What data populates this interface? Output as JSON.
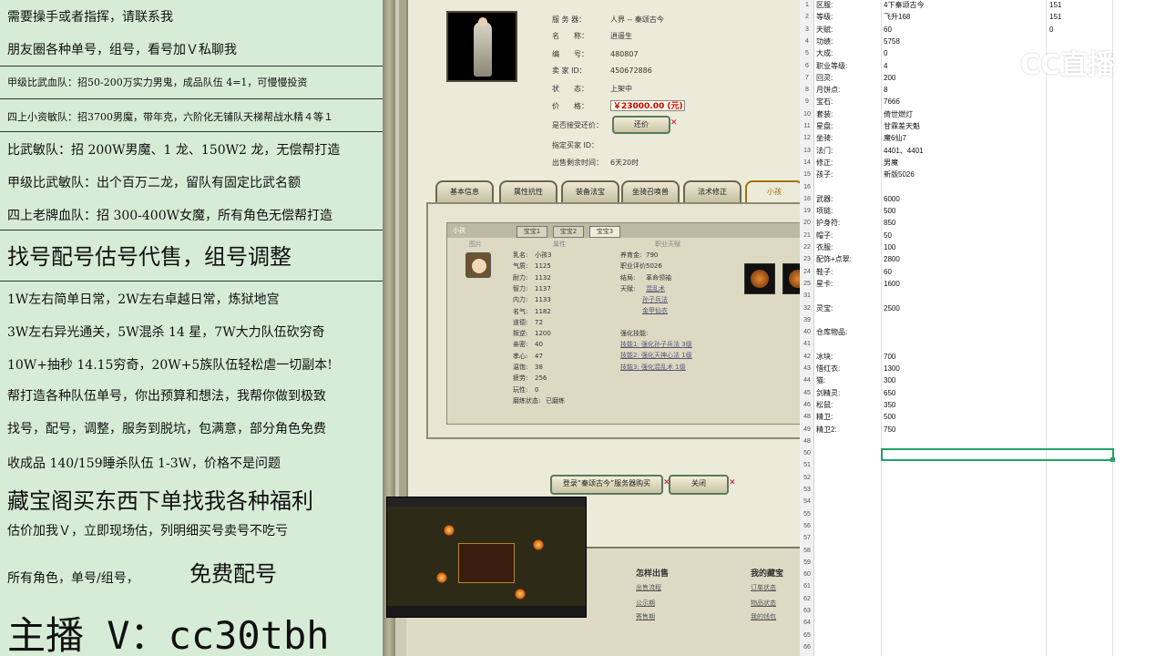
{
  "ad_panel": {
    "lines": [
      {
        "text": "需要操手或者指挥，请联系我",
        "size": "md"
      },
      {
        "text": "朋友圈各种单号，组号，看号加Ｖ私聊我",
        "size": "md"
      },
      {
        "text": "甲级比武血队：招50-200万实力男鬼，成品队伍 4=1，可慢慢投资",
        "size": "sm"
      },
      {
        "text": "四上小资敏队：招3700男魔，带年克，六阶化无铺队天梯帮战水精４等１",
        "size": "sm"
      },
      {
        "text": "比武敏队：招 200W男魔、1 龙、150W2 龙，无偿帮打造",
        "size": "md"
      },
      {
        "text": "甲级比武敏队：出个百万二龙，留队有固定比武名额",
        "size": "md"
      },
      {
        "text": "四上老牌血队：招 300-400W女魔，所有角色无偿帮打造",
        "size": "md"
      },
      {
        "text": "找号配号估号代售，组号调整",
        "size": "xl"
      },
      {
        "text": "1W左右简单日常，2W左右卓越日常，炼狱地宫",
        "size": "md"
      },
      {
        "text": "3W左右异光通关，5W混杀 14 星，7W大力队伍砍穷奇",
        "size": "md"
      },
      {
        "text": "10W+抽秒 14.15穷奇，20W+5族队伍轻松虐一切副本!",
        "size": "md"
      },
      {
        "text": "帮打造各种队伍单号，你出预算和想法，我帮你做到极致",
        "size": "md"
      },
      {
        "text": "找号，配号，调整，服务到脱坑，包满意，部分角色免费",
        "size": "md"
      },
      {
        "text": "收成品 140/159睡杀队伍 1-3W，价格不是问题",
        "size": "md"
      },
      {
        "text": "藏宝阁买东西下单找我各种福利",
        "size": "xl"
      },
      {
        "text": "估价加我Ｖ，立即现场估，列明细买号卖号不吃亏",
        "size": "md"
      },
      {
        "text": "所有角色，单号/组号，",
        "size": "md"
      },
      {
        "text": "免费配号",
        "size": "xl"
      },
      {
        "text": "主播 V：cc30tbh",
        "size": "xxl"
      }
    ]
  },
  "listing": {
    "server_label": "服 务 器：",
    "server_value": "人界 -- 秦颂古今",
    "name_label": "名　　称：",
    "name_value": "逍遥生",
    "id_label": "编　　号：",
    "id_value": "480807",
    "seller_label": "卖 家 ID：",
    "seller_value": "450672886",
    "status_label": "状　　态：",
    "status_value": "上架中",
    "price_label": "价　　格：",
    "price_value": "￥23000.00 (元)",
    "bargain_label": "是否接受还价：",
    "bargain_button": "还价",
    "buyer_label": "指定买家 ID：",
    "remain_label": "出售剩余时间：",
    "remain_value": "6天20时"
  },
  "tabs": [
    "基本信息",
    "属性抗性",
    "装备法宝",
    "坐骑召唤兽",
    "法术修正",
    "小孩"
  ],
  "child_panel": {
    "header": "小孩",
    "sub_tabs": [
      "宝宝1",
      "宝宝2",
      "宝宝3"
    ],
    "col_heads": [
      "图片",
      "属性",
      "职业天赋"
    ],
    "left_stats": [
      {
        "l": "乳名:",
        "v": "小孩3"
      },
      {
        "l": "气质:",
        "v": "1125"
      },
      {
        "l": "耐力:",
        "v": "1132"
      },
      {
        "l": "智力:",
        "v": "1137"
      },
      {
        "l": "内力:",
        "v": "1133"
      },
      {
        "l": "名气:",
        "v": "1182"
      },
      {
        "l": "道德:",
        "v": "72"
      },
      {
        "l": "叛逆:",
        "v": "1200"
      },
      {
        "l": "亲密:",
        "v": "40"
      },
      {
        "l": "孝心:",
        "v": "47"
      },
      {
        "l": "温饱:",
        "v": "38"
      },
      {
        "l": "疲劳:",
        "v": "256"
      },
      {
        "l": "玩性:",
        "v": "0"
      },
      {
        "l": "磨练状态:",
        "v": "已磨练"
      }
    ],
    "right_stats": [
      {
        "l": "养育金:",
        "v": "790"
      },
      {
        "l": "职业评价:",
        "v": "5026"
      },
      {
        "l": "结局:",
        "v": "革命领袖"
      },
      {
        "l": "天赋:",
        "v": "混乱术"
      }
    ],
    "talent_links": [
      "孙子兵法",
      "金甲仙衣"
    ],
    "skill_head": "强化技能:",
    "skill_links": [
      "技能1: 强化孙子兵法 3级",
      "技能2: 强化天神心法 1级",
      "技能3: 强化混乱术 1级"
    ]
  },
  "dialog_buttons": {
    "login": "登录“秦颂古今”服务器购买",
    "close": "关闭"
  },
  "lower": {
    "head1": "怎样出售",
    "links1": [
      "出售流程",
      "公示期",
      "寄售期"
    ],
    "head2": "我的藏宝",
    "links2": [
      "订单状态",
      "物品状态",
      "我的钱包"
    ]
  },
  "sheet": {
    "rows": [
      {
        "n": "1",
        "a": "区服:",
        "b": "4下秦颂古今",
        "c": "151"
      },
      {
        "n": "2",
        "a": "等级:",
        "b": "飞升168",
        "c": "151"
      },
      {
        "n": "3",
        "a": "天赋:",
        "b": "60",
        "c": "0"
      },
      {
        "n": "4",
        "a": "功绩:",
        "b": "5758",
        "c": ""
      },
      {
        "n": "5",
        "a": "大成:",
        "b": "0",
        "c": ""
      },
      {
        "n": "6",
        "a": "职业等级:",
        "b": "4",
        "c": ""
      },
      {
        "n": "7",
        "a": "回灵:",
        "b": "200",
        "c": ""
      },
      {
        "n": "8",
        "a": "月饼点:",
        "b": "8",
        "c": ""
      },
      {
        "n": "9",
        "a": "宝石:",
        "b": "7666",
        "c": ""
      },
      {
        "n": "10",
        "a": "套装:",
        "b": "倚世燃灯",
        "c": ""
      },
      {
        "n": "11",
        "a": "星盘:",
        "b": "甘霖差天魁",
        "c": ""
      },
      {
        "n": "12",
        "a": "坐骑:",
        "b": "魔6仙7",
        "c": ""
      },
      {
        "n": "13",
        "a": "法门:",
        "b": "4401、4401",
        "c": ""
      },
      {
        "n": "14",
        "a": "修正:",
        "b": "男魔",
        "c": ""
      },
      {
        "n": "15",
        "a": "孩子:",
        "b": "新版5026",
        "c": ""
      },
      {
        "n": "16",
        "a": "",
        "b": "",
        "c": ""
      },
      {
        "n": "18",
        "a": "武器:",
        "b": "6000",
        "c": ""
      },
      {
        "n": "19",
        "a": "项链:",
        "b": "500",
        "c": ""
      },
      {
        "n": "20",
        "a": "护身符:",
        "b": "850",
        "c": ""
      },
      {
        "n": "21",
        "a": "帽子:",
        "b": "50",
        "c": ""
      },
      {
        "n": "22",
        "a": "衣服:",
        "b": "100",
        "c": ""
      },
      {
        "n": "23",
        "a": "配饰+点翠:",
        "b": "2800",
        "c": ""
      },
      {
        "n": "24",
        "a": "鞋子:",
        "b": "60",
        "c": ""
      },
      {
        "n": "25",
        "a": "星卡:",
        "b": "1600",
        "c": ""
      },
      {
        "n": "31",
        "a": "",
        "b": "",
        "c": ""
      },
      {
        "n": "32",
        "a": "灵宝:",
        "b": "2500",
        "c": ""
      },
      {
        "n": "39",
        "a": "",
        "b": "",
        "c": ""
      },
      {
        "n": "40",
        "a": "仓库物品:",
        "b": "",
        "c": ""
      },
      {
        "n": "41",
        "a": "",
        "b": "",
        "c": ""
      },
      {
        "n": "42",
        "a": "冰块:",
        "b": "700",
        "c": ""
      },
      {
        "n": "43",
        "a": "惜红衣:",
        "b": "1300",
        "c": ""
      },
      {
        "n": "44",
        "a": "猫:",
        "b": "300",
        "c": ""
      },
      {
        "n": "45",
        "a": "剑精灵:",
        "b": "650",
        "c": ""
      },
      {
        "n": "46",
        "a": "松鼠:",
        "b": "350",
        "c": ""
      },
      {
        "n": "48",
        "a": "精卫:",
        "b": "500",
        "c": ""
      },
      {
        "n": "49",
        "a": "精卫2:",
        "b": "750",
        "c": ""
      },
      {
        "n": "48",
        "a": "",
        "b": "",
        "c": ""
      },
      {
        "n": "50",
        "a": "",
        "b": "",
        "c": ""
      },
      {
        "n": "51",
        "a": "",
        "b": "",
        "c": ""
      },
      {
        "n": "52",
        "a": "",
        "b": "",
        "c": ""
      },
      {
        "n": "53",
        "a": "",
        "b": "",
        "c": ""
      },
      {
        "n": "54",
        "a": "",
        "b": "",
        "c": ""
      },
      {
        "n": "55",
        "a": "",
        "b": "",
        "c": ""
      },
      {
        "n": "56",
        "a": "",
        "b": "",
        "c": ""
      },
      {
        "n": "57",
        "a": "",
        "b": "",
        "c": ""
      },
      {
        "n": "58",
        "a": "",
        "b": "",
        "c": ""
      },
      {
        "n": "59",
        "a": "",
        "b": "",
        "c": ""
      },
      {
        "n": "60",
        "a": "",
        "b": "",
        "c": ""
      },
      {
        "n": "61",
        "a": "",
        "b": "",
        "c": ""
      },
      {
        "n": "62",
        "a": "",
        "b": "",
        "c": ""
      },
      {
        "n": "63",
        "a": "",
        "b": "",
        "c": ""
      },
      {
        "n": "64",
        "a": "",
        "b": "",
        "c": ""
      },
      {
        "n": "65",
        "a": "",
        "b": "",
        "c": ""
      },
      {
        "n": "66",
        "a": "",
        "b": "",
        "c": ""
      }
    ]
  },
  "watermark": {
    "text": "CC直播"
  },
  "colors": {
    "ad_bg": "#d6ecd6",
    "price_red": "#cc0000",
    "selection_green": "#21a366"
  }
}
